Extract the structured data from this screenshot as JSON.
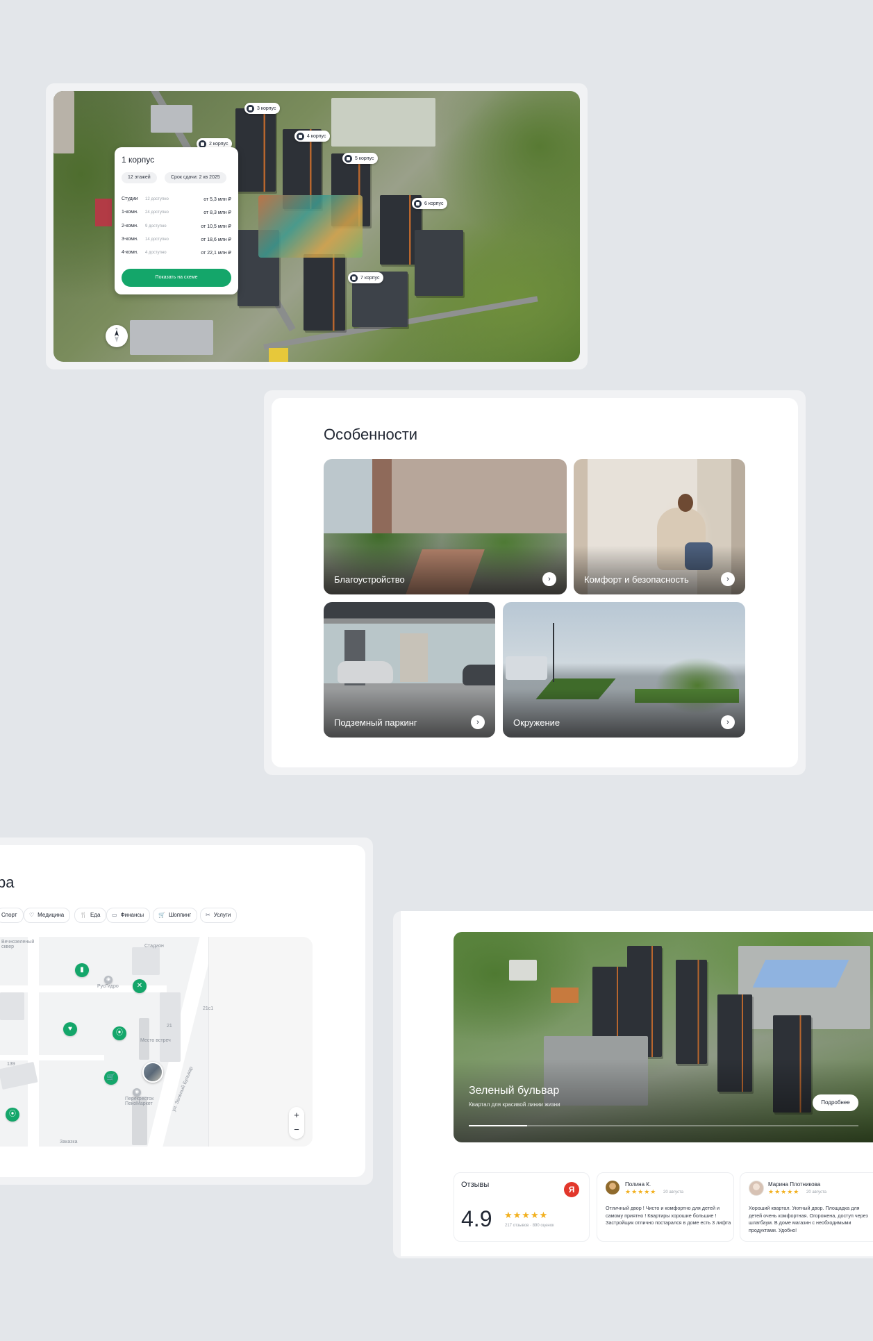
{
  "colors": {
    "accent_green": "#14a66a",
    "text_dark": "#222834",
    "background": "#e3e6ea",
    "star": "#f2b01e",
    "yandex_red": "#e2372b"
  },
  "aerial_map": {
    "building_pins": [
      {
        "label": "3 корпус"
      },
      {
        "label": "2 корпус"
      },
      {
        "label": "4 корпус"
      },
      {
        "label": "5 корпус"
      },
      {
        "label": "6 корпус"
      },
      {
        "label": "7 корпус"
      }
    ],
    "popup": {
      "title": "1 корпус",
      "chips": [
        "12 этажей",
        "Срок сдачи: 2 кв 2025"
      ],
      "rows": [
        {
          "type": "Студии",
          "available": "12 доступно",
          "price": "от 5,3 млн ₽"
        },
        {
          "type": "1-комн.",
          "available": "24 доступно",
          "price": "от 8,3 млн ₽"
        },
        {
          "type": "2-комн.",
          "available": "9 доступно",
          "price": "от 10,5 млн ₽"
        },
        {
          "type": "3-комн.",
          "available": "14 доступно",
          "price": "от 18,6 млн ₽"
        },
        {
          "type": "4-комн.",
          "available": "4 доступно",
          "price": "от 22,1 млн ₽"
        }
      ],
      "button": "Показать на схеме"
    },
    "compass_icon": "compass-icon"
  },
  "features": {
    "title": "Особенности",
    "tiles": [
      {
        "label": "Благоустройство"
      },
      {
        "label": "Комфорт и безопасность"
      },
      {
        "label": "Подземный паркинг"
      },
      {
        "label": "Окружение"
      }
    ],
    "arrow": "›"
  },
  "infrastructure": {
    "title_fragment": "ра",
    "categories": [
      {
        "label": "Спорт",
        "icon": "sport-icon"
      },
      {
        "label": "Медицина",
        "icon": "medicine-icon"
      },
      {
        "label": "Еда",
        "icon": "food-icon"
      },
      {
        "label": "Финансы",
        "icon": "finance-icon"
      },
      {
        "label": "Шоппинг",
        "icon": "cart-icon"
      },
      {
        "label": "Услуги",
        "icon": "scissors-icon"
      }
    ],
    "map_labels": {
      "park": "Вечнозеленый сквер",
      "place1": "РусГидро",
      "place2": "Место встреч",
      "place3": "Перекресток ПекоМаркет",
      "place4": "Заказка",
      "street": "ул. Зеленый Бульвар",
      "num1": "21с1",
      "num2": "21",
      "num3": "139",
      "stadium": "Стадион"
    },
    "zoom_in": "+",
    "zoom_out": "−"
  },
  "complex": {
    "title": "Зеленый бульвар",
    "subtitle": "Квартал для красивой линии жизни",
    "more_button": "Подробнее",
    "slide_progress": 0.15
  },
  "reviews": {
    "heading": "Отзывы",
    "source_badge": "Я",
    "rating": "4.9",
    "stars": "★★★★★",
    "reviews_count": "217 отзывов",
    "ratings_count": "890 оценок",
    "items": [
      {
        "name": "Полина К.",
        "date": "20 августа",
        "text": "Отличный двор ! Чисто и комфортно для детей и самому приятно ! Квартиры хорошие большие ! Застройщик отлично постарался в доме есть 3 лифта"
      },
      {
        "name": "Марина Плотникова",
        "date": "20 августа",
        "text": "Хороший квартал. Уютный двор. Площадка для детей очень комфортная. Огорожена, доступ через шлагбаум. В доме магазин с необходимыми продуктами. Удобно!"
      }
    ]
  }
}
